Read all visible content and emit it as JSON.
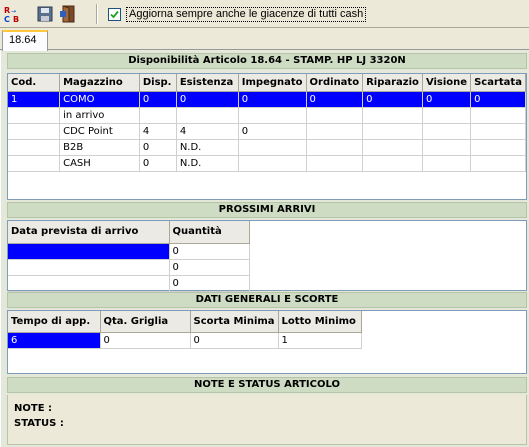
{
  "toolbar": {
    "buttons": [
      {
        "icon": "rcb-logo-icon"
      },
      {
        "icon": "save-disk-icon"
      },
      {
        "icon": "exit-door-icon"
      }
    ],
    "checkbox_checked": true,
    "checkbox_label": "Aggiorna sempre anche le giacenze di tutti cash"
  },
  "tabs": [
    {
      "label": "18.64"
    }
  ],
  "disponibilita": {
    "title": "Disponibilità Articolo 18.64 - STAMP. HP LJ 3320N",
    "columns": [
      "Cod.",
      "Magazzino",
      "Disp.",
      "Esistenza",
      "Impegnato",
      "Ordinato",
      "Riparazio",
      "Visione",
      "Scartata"
    ],
    "rows": [
      [
        "1",
        "COMO",
        "0",
        "0",
        "0",
        "0",
        "0",
        "0",
        "0"
      ],
      [
        "",
        "in arrivo",
        "",
        "",
        "",
        "",
        "",
        "",
        ""
      ],
      [
        "",
        "CDC Point",
        "4",
        "4",
        "0",
        "",
        "",
        "",
        ""
      ],
      [
        "",
        "B2B",
        "0",
        "N.D.",
        "",
        "",
        "",
        "",
        ""
      ],
      [
        "",
        "CASH",
        "0",
        "N.D.",
        "",
        "",
        "",
        "",
        ""
      ]
    ]
  },
  "arrivi": {
    "title": "PROSSIMI ARRIVI",
    "columns": [
      "Data prevista di arrivo",
      "Quantità"
    ],
    "rows": [
      [
        "",
        "0"
      ],
      [
        "",
        "0"
      ],
      [
        "",
        "0"
      ]
    ]
  },
  "scorte": {
    "title": "DATI GENERALI E SCORTE",
    "columns": [
      "Tempo di app.",
      "Qta. Griglia",
      "Scorta Minima",
      "Lotto Minimo"
    ],
    "rows": [
      [
        "6",
        "0",
        "0",
        "1"
      ]
    ]
  },
  "note": {
    "title": "NOTE E STATUS ARTICOLO",
    "note_label": "NOTE :",
    "status_label": "STATUS :"
  },
  "colors": {
    "selection": "#0000ff",
    "panel": "#e3e8da",
    "section_header": "#cfdcc4"
  }
}
